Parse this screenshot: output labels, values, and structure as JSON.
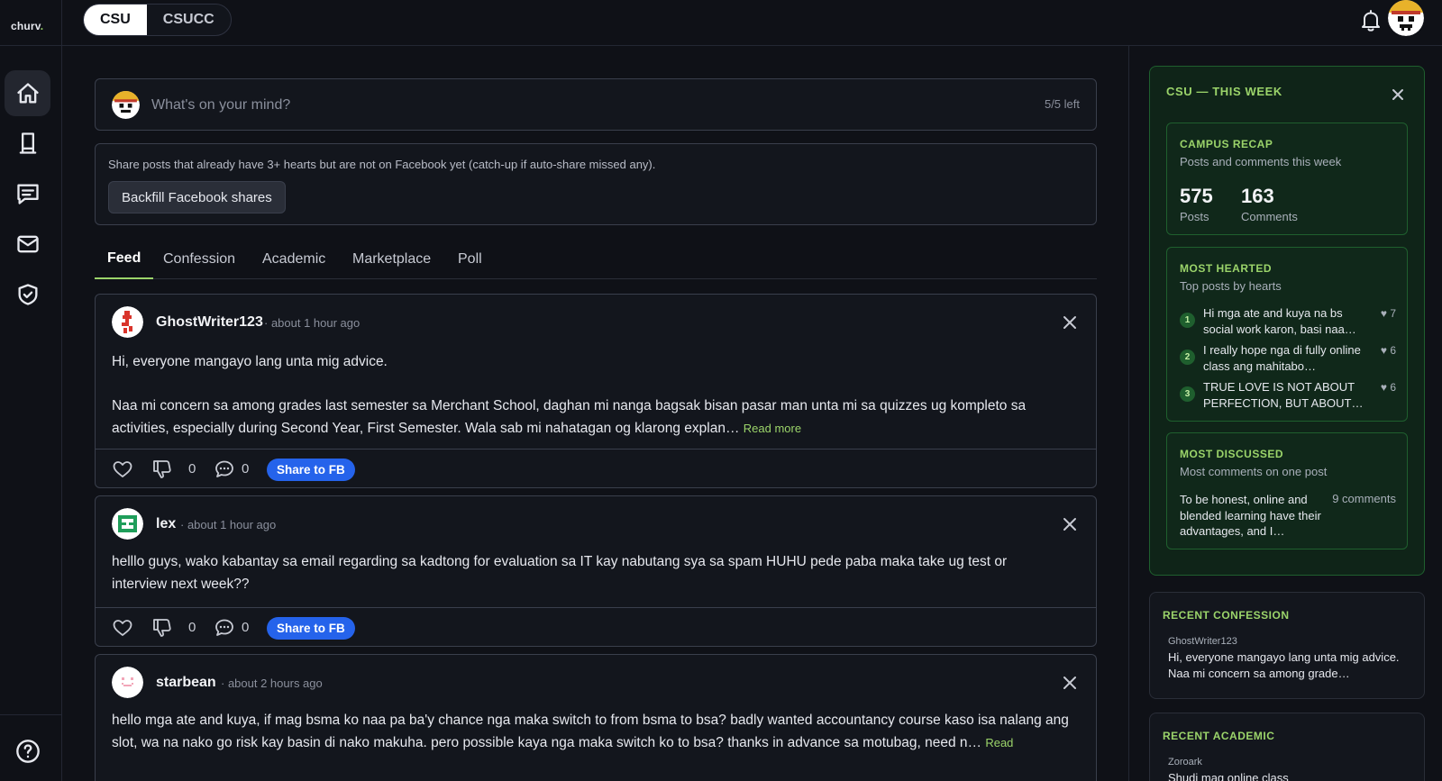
{
  "app": {
    "logo_text": "churv",
    "logo_dot": "."
  },
  "sidebar": {
    "items": [
      {
        "name": "home",
        "icon": "home-icon"
      },
      {
        "name": "academic",
        "icon": "phone-icon"
      },
      {
        "name": "messages",
        "icon": "chat-icon"
      },
      {
        "name": "mail",
        "icon": "mail-icon"
      },
      {
        "name": "moderation",
        "icon": "shield-check-icon"
      }
    ],
    "help_icon": "help-circle-icon"
  },
  "topbar": {
    "campus_options": [
      "CSU",
      "CSUCC"
    ],
    "selected_campus": "CSU"
  },
  "composer": {
    "placeholder": "What's on your mind?",
    "remaining": "5/5 left"
  },
  "backfill": {
    "description": "Share posts that already have 3+ hearts but are not on Facebook yet (catch-up if auto-share missed any).",
    "button_label": "Backfill Facebook shares"
  },
  "tabs": [
    "Feed",
    "Confession",
    "Academic",
    "Marketplace",
    "Poll"
  ],
  "active_tab": "Feed",
  "posts": [
    {
      "author": "GhostWriter123",
      "time": "· about 1 hour ago",
      "paragraphs": [
        "Hi, everyone mangayo lang unta mig advice.",
        "Naa mi concern sa among grades last semester sa Merchant School, daghan mi nanga bagsak bisan pasar man unta mi sa quizzes ug kompleto sa activities, especially during Second Year, First Semester. Wala sab mi nahatagan og klarong explan…"
      ],
      "read_more": "Read more",
      "likes": "0",
      "comments": "0",
      "share_label": "Share to FB"
    },
    {
      "author": "lex",
      "time": "· about 1 hour ago",
      "paragraphs": [
        "helllo guys, wako kabantay sa email regarding sa kadtong for evaluation sa IT kay nabutang sya sa spam HUHU pede paba maka take ug test or interview next week??"
      ],
      "read_more": "",
      "likes": "0",
      "comments": "0",
      "share_label": "Share to FB"
    },
    {
      "author": "starbean",
      "time": "· about 2 hours ago",
      "paragraphs": [
        "hello mga ate and kuya, if mag bsma ko naa pa ba'y chance nga maka switch to from bsma to bsa? badly wanted accountancy course kaso isa nalang ang slot, wa na nako go risk kay basin di nako makuha. pero possible kaya nga maka switch ko to bsa? thanks in advance sa motubag, need n…"
      ],
      "read_more": "Read"
    }
  ],
  "week_panel": {
    "title": "CSU — THIS WEEK",
    "recap": {
      "title": "CAMPUS RECAP",
      "subtitle": "Posts and comments this week",
      "posts_count": "575",
      "posts_label": "Posts",
      "comments_count": "163",
      "comments_label": "Comments"
    },
    "most_hearted": {
      "title": "MOST HEARTED",
      "subtitle": "Top posts by hearts",
      "items": [
        {
          "rank": "1",
          "text": "Hi mga ate and kuya na bs social work karon, basi naa…",
          "hearts": "7"
        },
        {
          "rank": "2",
          "text": "I really hope nga di fully online class ang mahitabo…",
          "hearts": "6"
        },
        {
          "rank": "3",
          "text": "TRUE LOVE IS NOT ABOUT PERFECTION, BUT ABOUT…",
          "hearts": "6"
        }
      ]
    },
    "most_discussed": {
      "title": "MOST DISCUSSED",
      "subtitle": "Most comments on one post",
      "text": "To be honest, online and blended learning have their advantages, and I…",
      "count": "9 comments"
    }
  },
  "recent_confession": {
    "title": "RECENT CONFESSION",
    "user": "GhostWriter123",
    "text": "Hi, everyone mangayo lang unta mig advice. Naa mi concern sa among grade…"
  },
  "recent_academic": {
    "title": "RECENT ACADEMIC",
    "user": "Zoroark",
    "text": "Shudi mag online class"
  },
  "colors": {
    "accent": "#9bd46a",
    "share": "#2563eb",
    "background": "#0f1117",
    "panel": "#0f2418"
  }
}
